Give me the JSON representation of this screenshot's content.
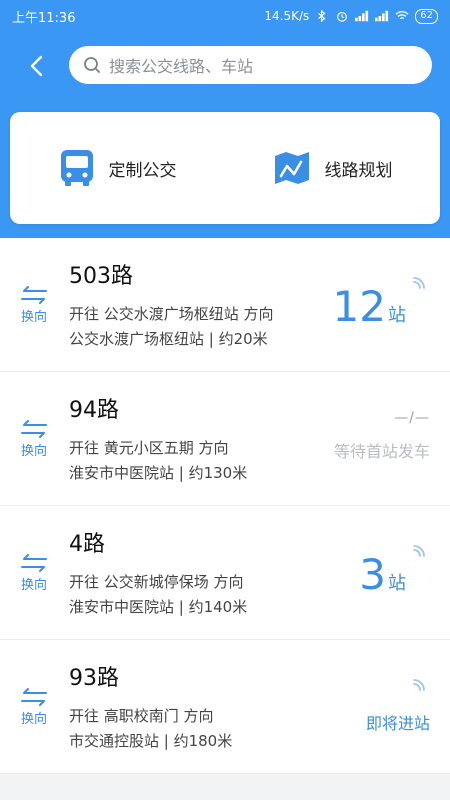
{
  "status_bar": {
    "time": "上午11:36",
    "network_speed": "14.5K/s",
    "battery": "62"
  },
  "search": {
    "placeholder": "搜索公交线路、车站"
  },
  "shortcuts": [
    {
      "label": "定制公交",
      "icon": "bus-icon"
    },
    {
      "label": "线路规划",
      "icon": "map-route-icon"
    }
  ],
  "routes": [
    {
      "name": "503路",
      "line1": "开往 公交水渡广场枢纽站 方向",
      "line2": "公交水渡广场枢纽站 | 约20米",
      "swap": "换向",
      "stops_num": "12",
      "stops_unit": "站"
    },
    {
      "name": "94路",
      "line1": "开往 黄元小区五期 方向",
      "line2": "淮安市中医院站 | 约130米",
      "swap": "换向",
      "dash": "—/—",
      "status": "等待首站发车"
    },
    {
      "name": "4路",
      "line1": "开往 公交新城停保场 方向",
      "line2": "淮安市中医院站 | 约140米",
      "swap": "换向",
      "stops_num": "3",
      "stops_unit": "站"
    },
    {
      "name": "93路",
      "line1": "开往 高职校南门 方向",
      "line2": "市交通控股站 | 约180米",
      "swap": "换向",
      "status": "即将进站"
    }
  ],
  "colors": {
    "accent": "#3a97f4",
    "link": "#3a8ee6"
  }
}
